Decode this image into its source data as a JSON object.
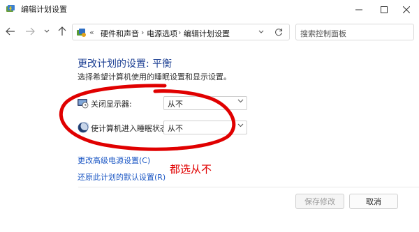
{
  "window": {
    "title": "编辑计划设置",
    "icon": "power-options-icon"
  },
  "nav": {
    "breadcrumb_overflow": "«",
    "breadcrumbs": [
      "硬件和声音",
      "电源选项",
      "编辑计划设置"
    ],
    "search_placeholder": "搜索控制面板"
  },
  "content": {
    "heading": "更改计划的设置: 平衡",
    "description": "选择希望计算机使用的睡眠设置和显示设置。",
    "settings": [
      {
        "label": "关闭显示器:",
        "value": "从不",
        "icon": "monitor-icon"
      },
      {
        "label": "使计算机进入睡眠状态:",
        "value": "从不",
        "icon": "moon-icon"
      }
    ],
    "links": {
      "advanced": "更改高级电源设置(C)",
      "restore": "还原此计划的默认设置(R)"
    },
    "annotation": {
      "text": "都选从不",
      "color": "#e00000"
    }
  },
  "footer": {
    "save_label": "保存修改",
    "cancel_label": "取消"
  }
}
